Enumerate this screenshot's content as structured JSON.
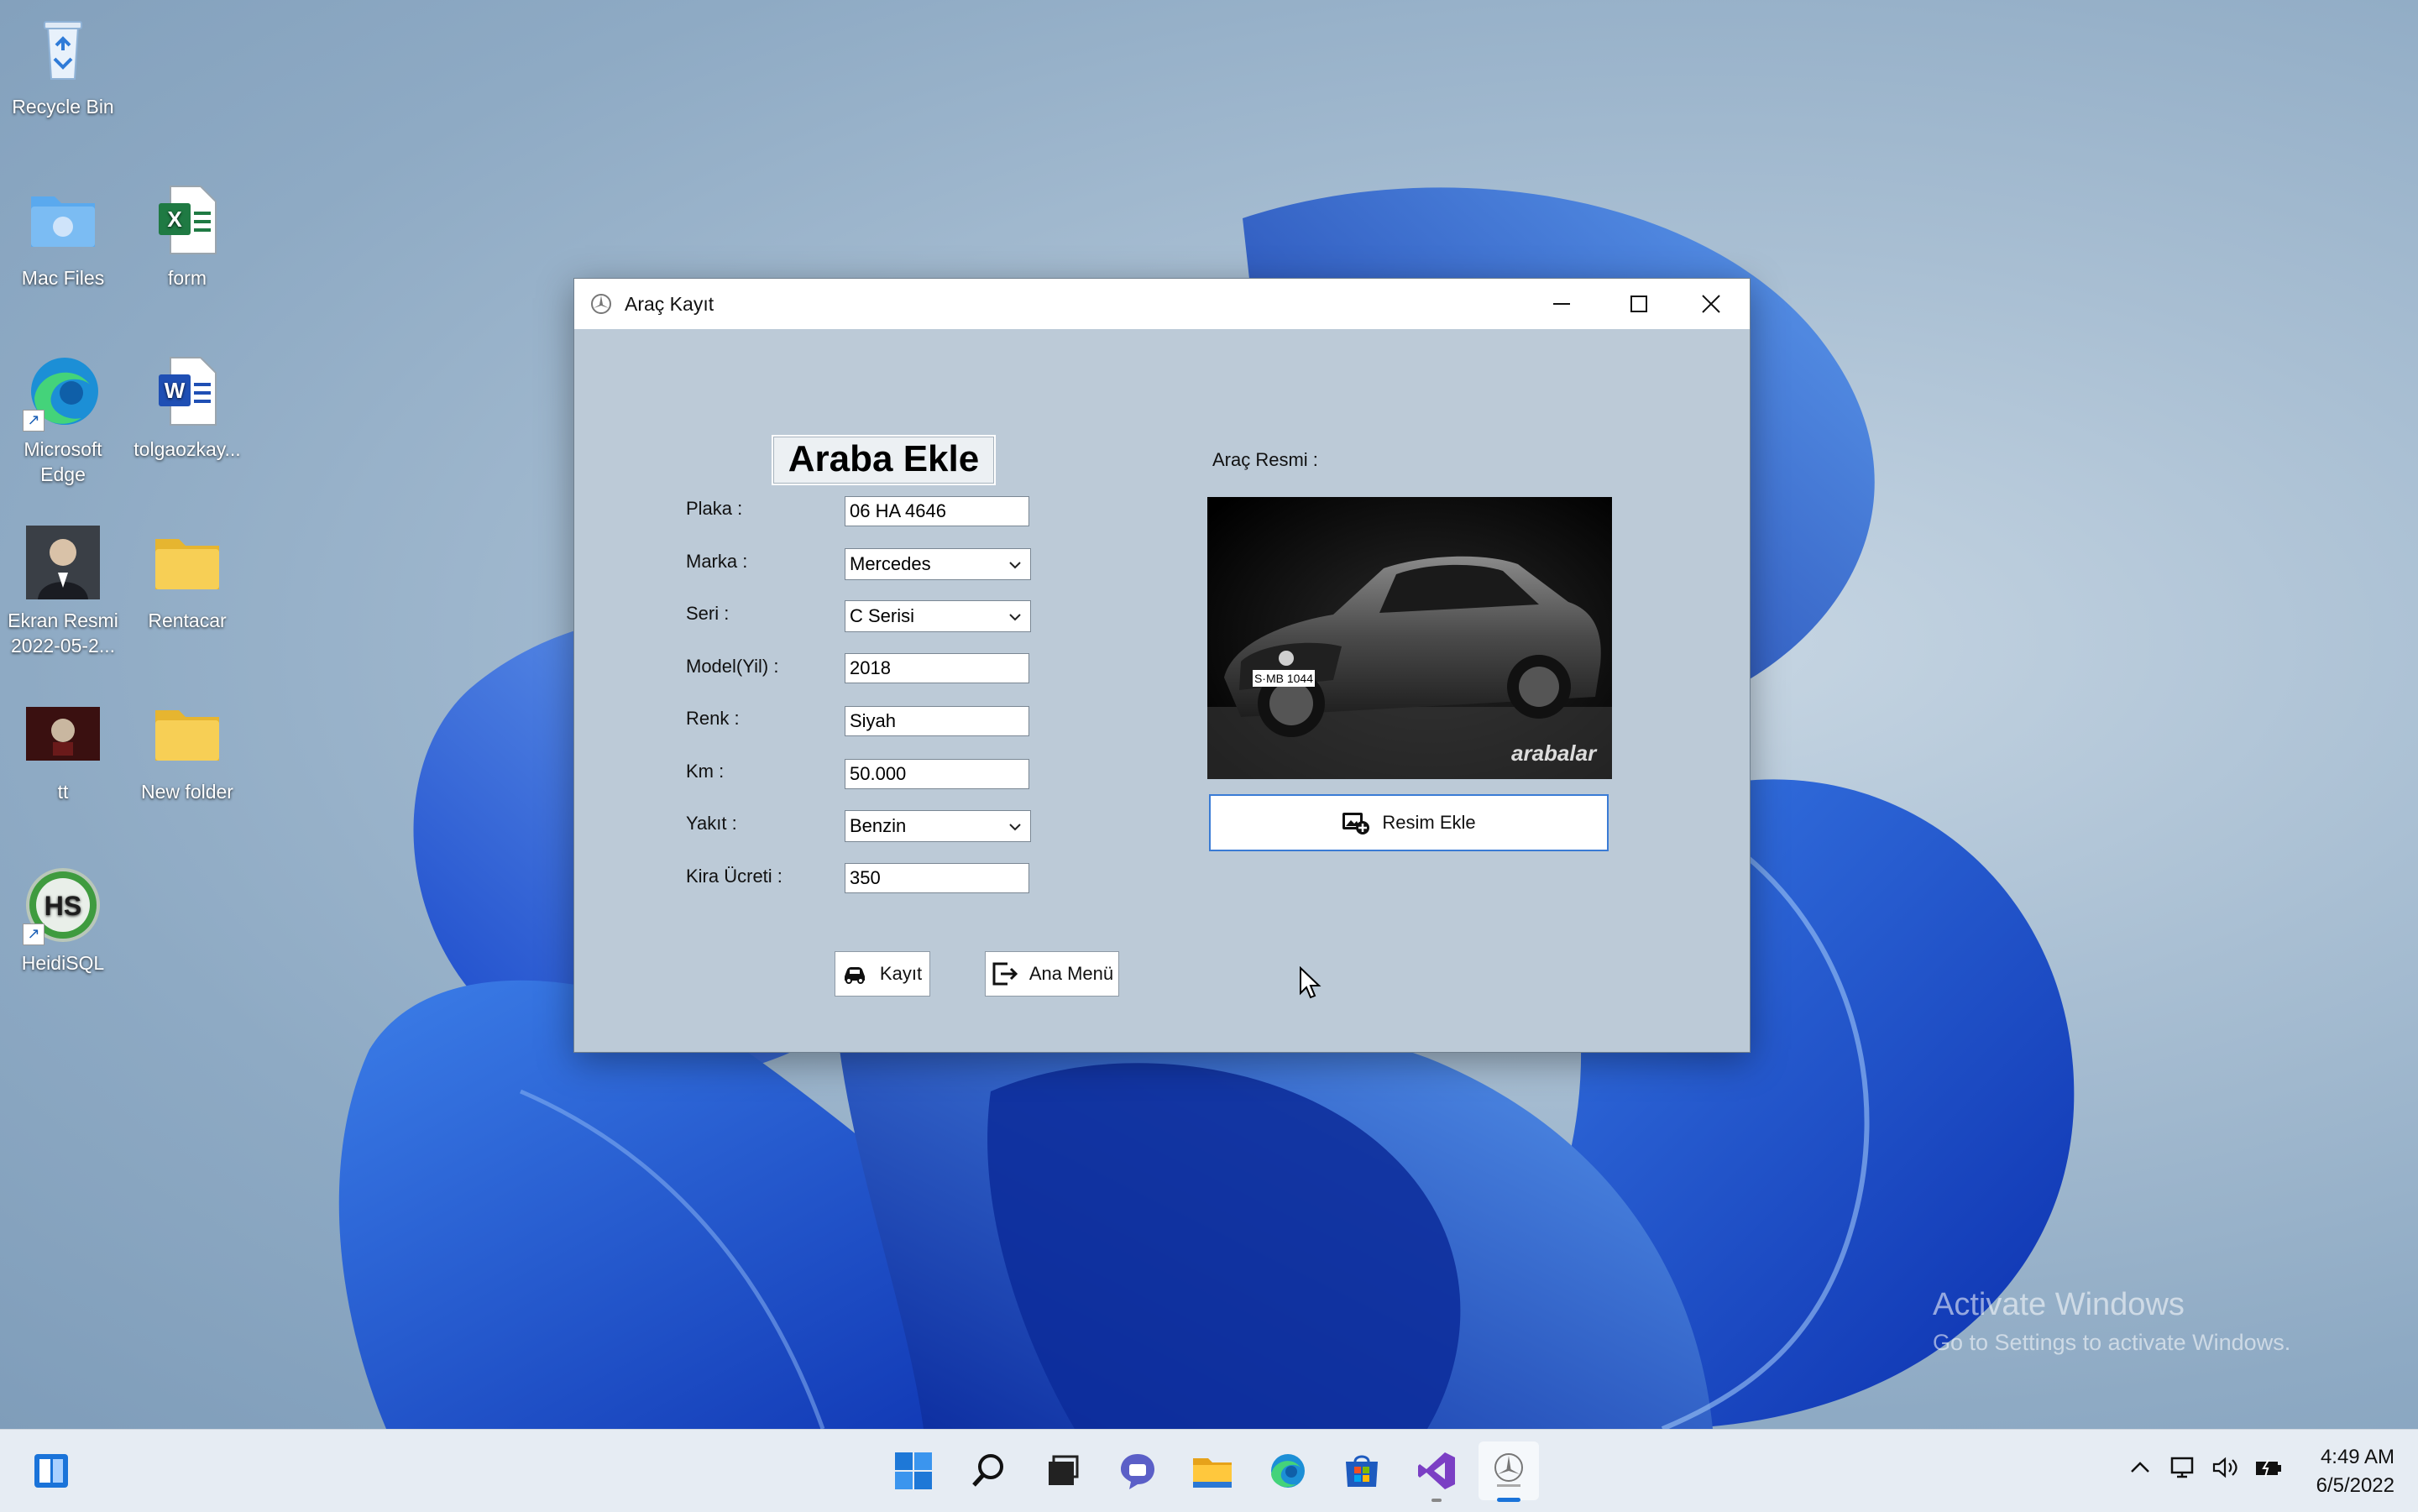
{
  "desktop": {
    "icons": [
      {
        "label": "Recycle Bin"
      },
      {
        "label": "Mac Files"
      },
      {
        "label": "form"
      },
      {
        "label": "Microsoft Edge"
      },
      {
        "label": "tolgaozkay..."
      },
      {
        "label": "Ekran Resmi 2022-05-2..."
      },
      {
        "label": "Rentacar"
      },
      {
        "label": "tt"
      },
      {
        "label": "New folder"
      },
      {
        "label": "HeidiSQL"
      }
    ],
    "watermark": {
      "line1": "Activate Windows",
      "line2": "Go to Settings to activate Windows."
    }
  },
  "window": {
    "title": "Araç Kayıt",
    "heading": "Araba Ekle",
    "fields": {
      "plaka": {
        "label": "Plaka :",
        "value": "06 HA 4646"
      },
      "marka": {
        "label": "Marka :",
        "value": "Mercedes"
      },
      "seri": {
        "label": "Seri :",
        "value": "C Serisi"
      },
      "model": {
        "label": "Model(Yil) :",
        "value": "2018"
      },
      "renk": {
        "label": "Renk :",
        "value": "Siyah"
      },
      "km": {
        "label": "Km :",
        "value": "50.000"
      },
      "yakit": {
        "label": "Yakıt :",
        "value": "Benzin"
      },
      "kira": {
        "label": "Kira Ücreti :",
        "value": "350"
      }
    },
    "photo_label": "Araç Resmi :",
    "photo_plate": "S·MB 1044",
    "photo_watermark": "arabalar",
    "resim_ekle_label": "Resim Ekle",
    "kayit_label": "Kayıt",
    "ana_menu_label": "Ana Menü"
  },
  "taskbar": {
    "time": "4:49 AM",
    "date": "6/5/2022"
  }
}
